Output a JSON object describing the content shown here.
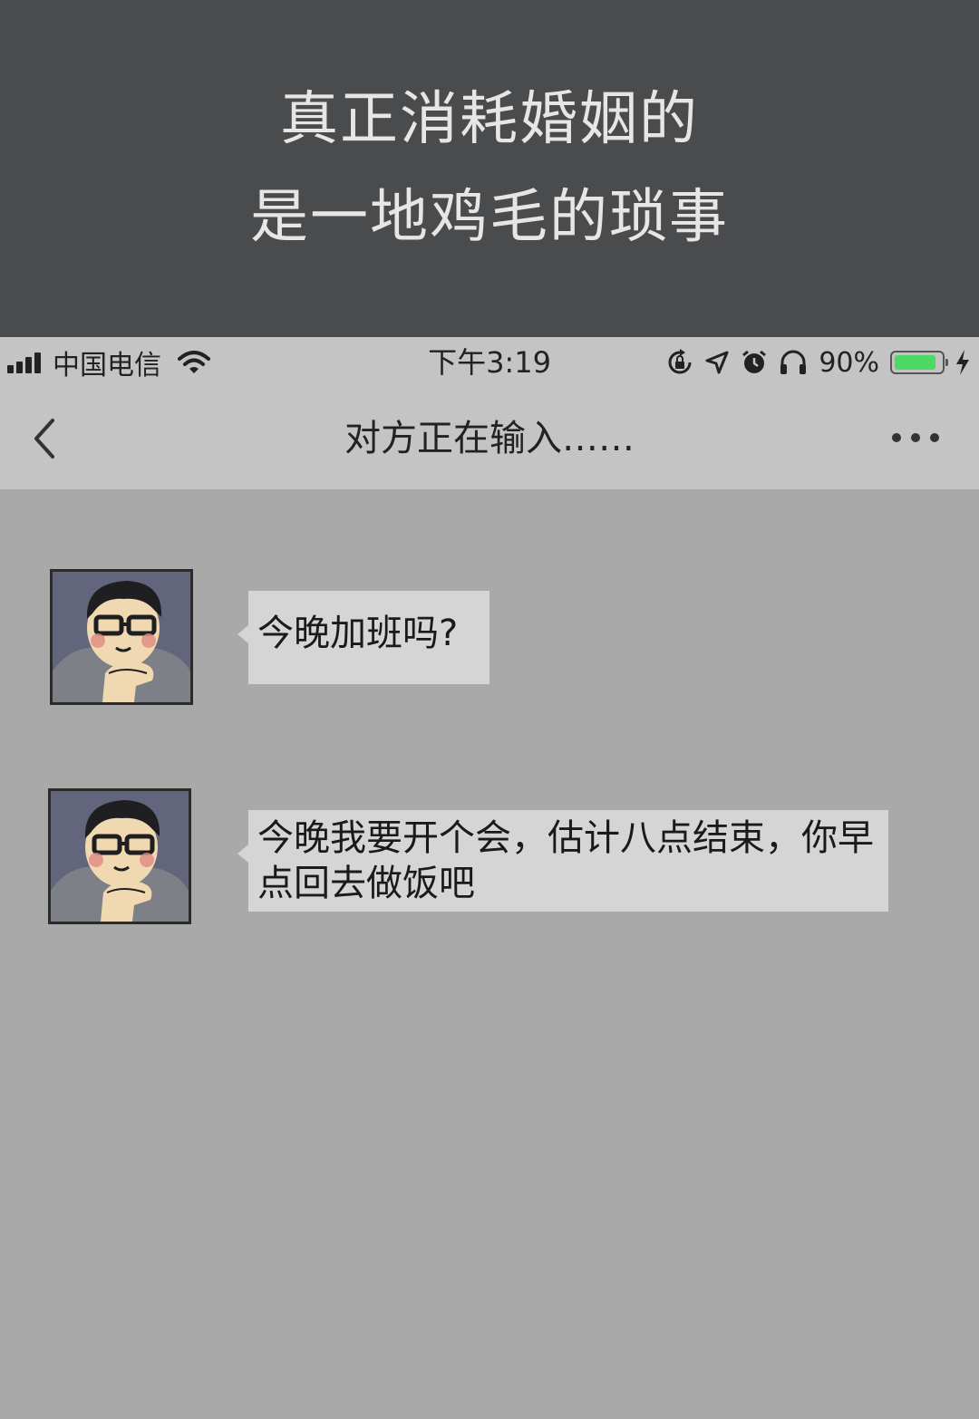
{
  "banner": {
    "line1": "真正消耗婚姻的",
    "line2": "是一地鸡毛的琐事"
  },
  "status_bar": {
    "carrier": "中国电信",
    "time": "下午3:19",
    "battery_percent_text": "90%",
    "battery_level": 0.9,
    "icons": [
      "signal-icon",
      "wifi-icon",
      "rotation-lock-icon",
      "location-icon",
      "alarm-icon",
      "headphones-icon",
      "battery-icon",
      "charging-icon"
    ]
  },
  "nav": {
    "title": "对方正在输入……",
    "icons": [
      "back-chevron-icon",
      "more-icon"
    ]
  },
  "messages": [
    {
      "text": "今晚加班吗?"
    },
    {
      "text": "今晚我要开个会，估计八点结束，你早点回去做饭吧"
    }
  ],
  "colors": {
    "banner_bg": "#4a4b4d",
    "bar_bg": "#c4c4c5",
    "chat_bg": "#a9a9aa",
    "bubble_bg": "#d5d5d6",
    "battery_fill": "#4cd964"
  }
}
